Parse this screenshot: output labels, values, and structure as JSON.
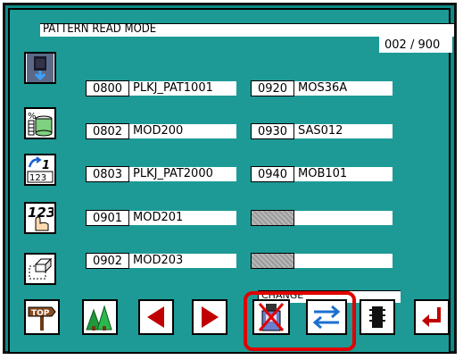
{
  "screen": {
    "title": "PATTERN READ MODE",
    "counter": "002 / 900"
  },
  "side_buttons": [
    {
      "icon": "floppy-read-icon"
    },
    {
      "icon": "percent-database-icon"
    },
    {
      "icon": "renumber-123-icon"
    },
    {
      "icon": "hand-number-input-icon"
    },
    {
      "icon": "eraser-icon"
    }
  ],
  "patterns": {
    "left": [
      {
        "number": "0800",
        "name": "PLKJ_PAT1001"
      },
      {
        "number": "0802",
        "name": "MOD200"
      },
      {
        "number": "0803",
        "name": "PLKJ_PAT2000"
      },
      {
        "number": "0901",
        "name": "MOD201"
      },
      {
        "number": "0902",
        "name": "MOD203"
      }
    ],
    "right": [
      {
        "number": "0920",
        "name": "MOS36A"
      },
      {
        "number": "0930",
        "name": "SAS012"
      },
      {
        "number": "0940",
        "name": "MOB101"
      },
      {
        "number": "",
        "name": ""
      },
      {
        "number": "",
        "name": ""
      }
    ]
  },
  "bottom": {
    "change_label": "CHANGE",
    "buttons": [
      "top-icon",
      "tree-icon",
      "left-arrow-icon",
      "right-arrow-icon",
      "device-disabled-icon",
      "swap-arrows-icon",
      "memory-chip-icon",
      "enter-icon"
    ]
  },
  "colors": {
    "background": "#1d9a96",
    "highlight": "#e00000",
    "arrow": "#c00000",
    "swap": "#1a6fd0"
  }
}
